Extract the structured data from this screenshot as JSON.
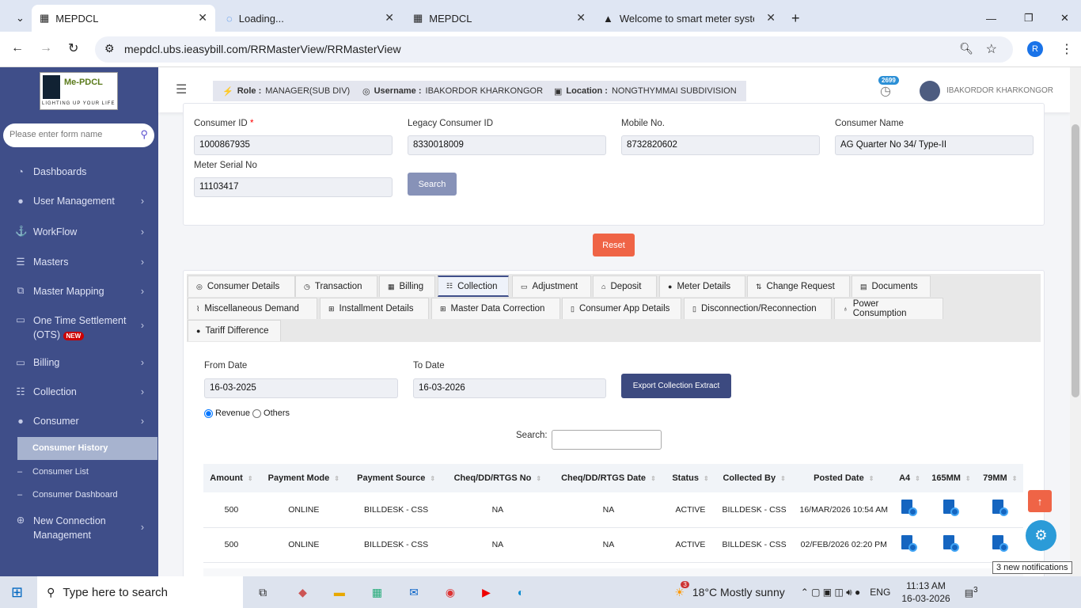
{
  "browser": {
    "tabs": [
      {
        "title": "MEPDCL",
        "active": true
      },
      {
        "title": "Loading...",
        "active": false
      },
      {
        "title": "MEPDCL",
        "active": false
      },
      {
        "title": "Welcome to smart meter systen",
        "active": false
      }
    ],
    "url": "mepdcl.ubs.ieasybill.com/RRMasterView/RRMasterView",
    "profile_initial": "R"
  },
  "sidebar": {
    "logo_text": "Me-PDCL",
    "logo_tagline": "LIGHTING UP YOUR LIFE",
    "search_placeholder": "Please enter form name",
    "items": [
      {
        "label": "Dashboards"
      },
      {
        "label": "User Management"
      },
      {
        "label": "WorkFlow"
      },
      {
        "label": "Masters"
      },
      {
        "label": "Master Mapping"
      },
      {
        "label": "One Time Settlement (OTS)",
        "badge": "NEW"
      },
      {
        "label": "Billing"
      },
      {
        "label": "Collection"
      },
      {
        "label": "Consumer"
      },
      {
        "label": "New Connection Management"
      }
    ],
    "subitems": [
      {
        "label": "Consumer History",
        "active": true
      },
      {
        "label": "Consumer List"
      },
      {
        "label": "Consumer Dashboard"
      }
    ]
  },
  "header": {
    "role_label": "Role :",
    "role": "MANAGER(SUB DIV)",
    "username_label": "Username :",
    "username": "IBAKORDOR KHARKONGOR",
    "location_label": "Location :",
    "location": "NONGTHYMMAI SUBDIVISION",
    "notif_count": "2699",
    "user_name": "IBAKORDOR KHARKONGOR"
  },
  "search_form": {
    "consumer_id_label": "Consumer ID",
    "consumer_id": "1000867935",
    "legacy_label": "Legacy Consumer ID",
    "legacy": "8330018009",
    "mobile_label": "Mobile No.",
    "mobile": "8732820602",
    "name_label": "Consumer Name",
    "name": "AG Quarter No 34/ Type-II",
    "meter_label": "Meter Serial No",
    "meter": "11103417",
    "search_btn": "Search",
    "reset_btn": "Reset"
  },
  "tabs": [
    "Consumer Details",
    "Transaction",
    "Billing",
    "Collection",
    "Adjustment",
    "Deposit",
    "Meter Details",
    "Change Request",
    "Documents",
    "Miscellaneous Demand",
    "Installment Details",
    "Master Data Correction",
    "Consumer App Details",
    "Disconnection/Reconnection",
    "Power Consumption",
    "Tariff Difference"
  ],
  "collection": {
    "from_label": "From Date",
    "from": "16-03-2025",
    "to_label": "To Date",
    "to": "16-03-2026",
    "export_btn": "Export Collection Extract",
    "radio_revenue": "Revenue",
    "radio_others": "Others",
    "selected": "Revenue",
    "search_label": "Search:",
    "columns": [
      "Amount",
      "Payment Mode",
      "Payment Source",
      "Cheq/DD/RTGS No",
      "Cheq/DD/RTGS Date",
      "Status",
      "Collected By",
      "Posted Date",
      "A4",
      "165MM",
      "79MM"
    ],
    "rows": [
      [
        "500",
        "ONLINE",
        "BILLDESK - CSS",
        "NA",
        "NA",
        "ACTIVE",
        "BILLDESK - CSS",
        "16/MAR/2026 10:54 AM"
      ],
      [
        "500",
        "ONLINE",
        "BILLDESK - CSS",
        "NA",
        "NA",
        "ACTIVE",
        "BILLDESK - CSS",
        "02/FEB/2026 02:20 PM"
      ]
    ]
  },
  "tooltip": "3 new notifications",
  "taskbar": {
    "search_placeholder": "Type here to search",
    "weather": "18°C  Mostly sunny",
    "weather_badge": "3",
    "lang": "ENG",
    "time": "11:13 AM",
    "date": "16-03-2026",
    "notif": "3"
  }
}
